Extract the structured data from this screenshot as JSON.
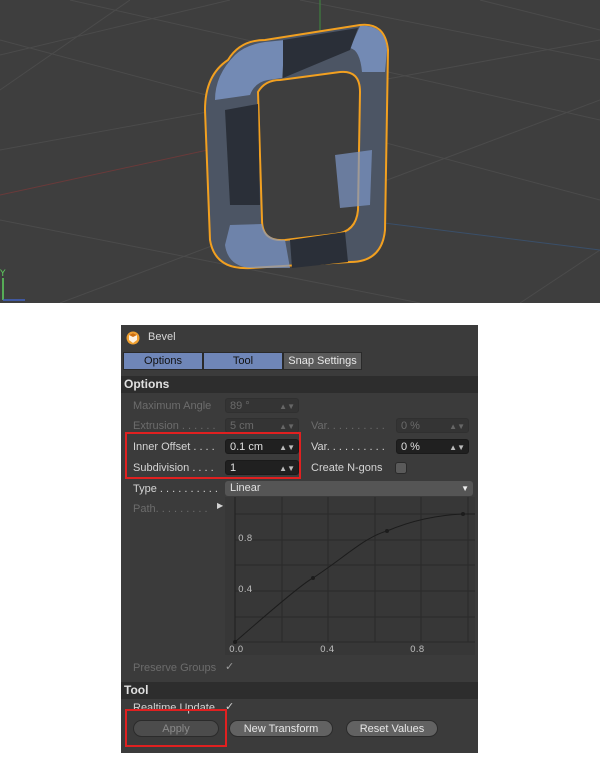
{
  "viewport": {
    "axis_y_label": "Y",
    "colors": {
      "background": "#3e3e3e",
      "object_outline": "#f2a020",
      "object_fill": "#5a6678",
      "bevel": "#7a9ad0"
    }
  },
  "panel": {
    "title": "Bevel",
    "app_icon": "cinema4d-icon",
    "tabs": [
      {
        "label": "Options",
        "active": true
      },
      {
        "label": "Tool",
        "active": true
      },
      {
        "label": "Snap Settings",
        "active": false
      }
    ],
    "options_section": {
      "header": "Options",
      "maximum_angle": {
        "label": "Maximum Angle",
        "value": "89 °",
        "enabled": false
      },
      "extrusion": {
        "label": "Extrusion . . . . . .",
        "value": "5 cm",
        "enabled": false
      },
      "extrusion_var": {
        "label": "Var. . . . . . . . . .",
        "value": "0 %",
        "enabled": false
      },
      "inner_offset": {
        "label": "Inner Offset . . . .",
        "value": "0.1 cm",
        "enabled": true
      },
      "inner_offset_var": {
        "label": "Var. . . . . . . . . .",
        "value": "0 %",
        "enabled": true
      },
      "subdivision": {
        "label": "Subdivision . . . .",
        "value": "1",
        "enabled": true
      },
      "create_ngons": {
        "label": "Create N-gons",
        "checked": false
      },
      "type": {
        "label": "Type . . . . . . . . . .",
        "value": "Linear"
      },
      "path": {
        "label": "Path. . . . . . . . .",
        "arrow": "play-icon"
      },
      "graph": {
        "x_ticks": [
          "0.0",
          "0.4",
          "0.8"
        ],
        "y_ticks": [
          "0.4",
          "0.8"
        ]
      },
      "preserve_groups": {
        "label": "Preserve Groups",
        "checked": true
      }
    },
    "tool_section": {
      "header": "Tool",
      "realtime_update": {
        "label": "Realtime Update",
        "checked": true
      },
      "buttons": {
        "apply": "Apply",
        "new_transform": "New Transform",
        "reset_values": "Reset Values"
      }
    },
    "highlight_color": "#e02020"
  }
}
